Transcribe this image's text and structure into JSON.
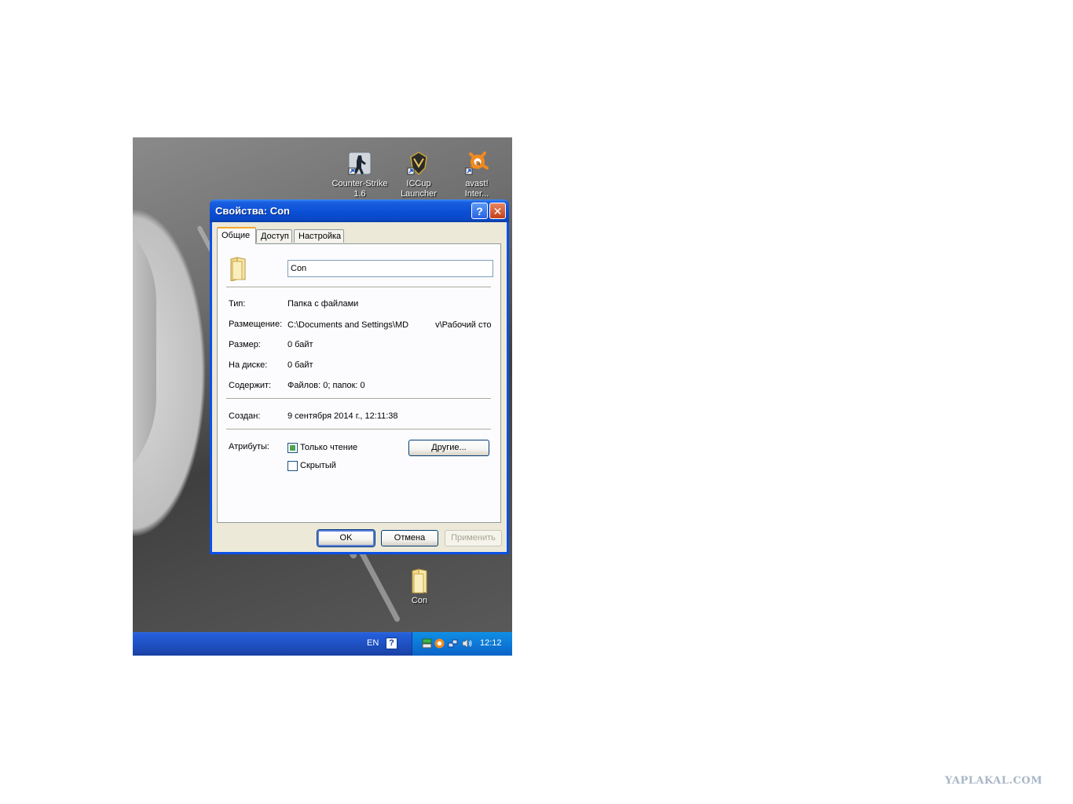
{
  "desktop": {
    "cut_label": "",
    "icons": [
      {
        "label_line1": "Counter-Strike",
        "label_line2": "1.6"
      },
      {
        "label_line1": "ICCup",
        "label_line2": "Launcher"
      },
      {
        "label_line1": "avast!",
        "label_line2": "Inter..."
      },
      {
        "label_line1": "Con",
        "label_line2": ""
      }
    ]
  },
  "taskbar": {
    "language": "EN",
    "help_glyph": "?",
    "clock": "12:12"
  },
  "window": {
    "title": "Свойства: Con",
    "help_glyph": "?",
    "close_glyph": "✕",
    "tabs": [
      "Общие",
      "Доступ",
      "Настройка"
    ],
    "folder_name": "Con",
    "fields": {
      "type_label": "Тип:",
      "type_value": "Папка с файлами",
      "location_label": "Размещение:",
      "location_value_a": "C:\\Documents and Settings\\MD",
      "location_value_b": "v\\Рабочий сто",
      "size_label": "Размер:",
      "size_value": "0 байт",
      "ondisk_label": "На диске:",
      "ondisk_value": "0 байт",
      "contains_label": "Содержит:",
      "contains_value": "Файлов: 0; папок: 0",
      "created_label": "Создан:",
      "created_value": "9 сентября 2014 г., 12:11:38",
      "attributes_label": "Атрибуты:",
      "readonly_label": "Только чтение",
      "hidden_label": "Скрытый",
      "other_button": "Другие..."
    },
    "buttons": {
      "ok": "OK",
      "cancel": "Отмена",
      "apply": "Применить"
    }
  },
  "watermark": "YAPLAKAL.COM"
}
